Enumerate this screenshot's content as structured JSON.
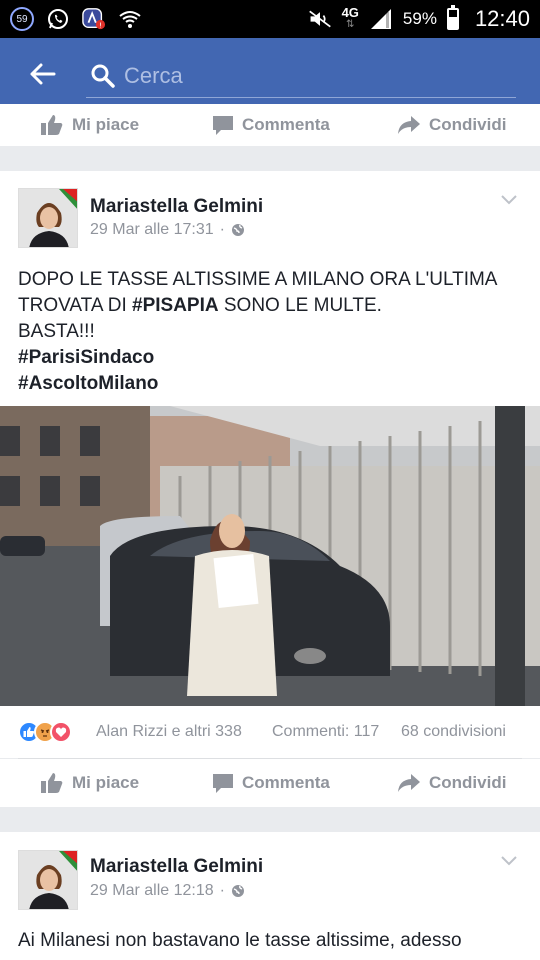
{
  "status_bar": {
    "notification_count": "59",
    "network": "4G",
    "battery_percent": "59%",
    "battery_level": 0.59,
    "time": "12:40"
  },
  "search": {
    "placeholder": "Cerca",
    "value": ""
  },
  "actions": {
    "like": "Mi piace",
    "comment": "Commenta",
    "share": "Condividi"
  },
  "posts": [
    {
      "author": "Mariastella Gelmini",
      "timestamp": "29 Mar alle 17:31",
      "privacy_icon": "globe-icon",
      "text": {
        "line1": "DOPO LE TASSE ALTISSIME A MILANO ORA L'ULTIMA",
        "line2_pre": "TROVATA DI ",
        "line2_bold": "#PISAPIA",
        "line2_post": " SONO LE MULTE.",
        "line3": "BASTA!!!",
        "line4": "#ParisiSindaco",
        "line5": "#AscoltoMilano"
      },
      "reactions_text": "Alan Rizzi e altri 338",
      "comments_text": "Commenti: 117",
      "shares_text": "68 condivisioni"
    },
    {
      "author": "Mariastella Gelmini",
      "timestamp": "29 Mar alle 12:18",
      "privacy_icon": "globe-icon",
      "text_line1": "Ai Milanesi non bastavano le tasse altissime, adesso"
    }
  ],
  "colors": {
    "brand": "#4267b2",
    "like_blue": "#2d88ff",
    "angry": "#f0a24b",
    "love": "#f25268"
  }
}
